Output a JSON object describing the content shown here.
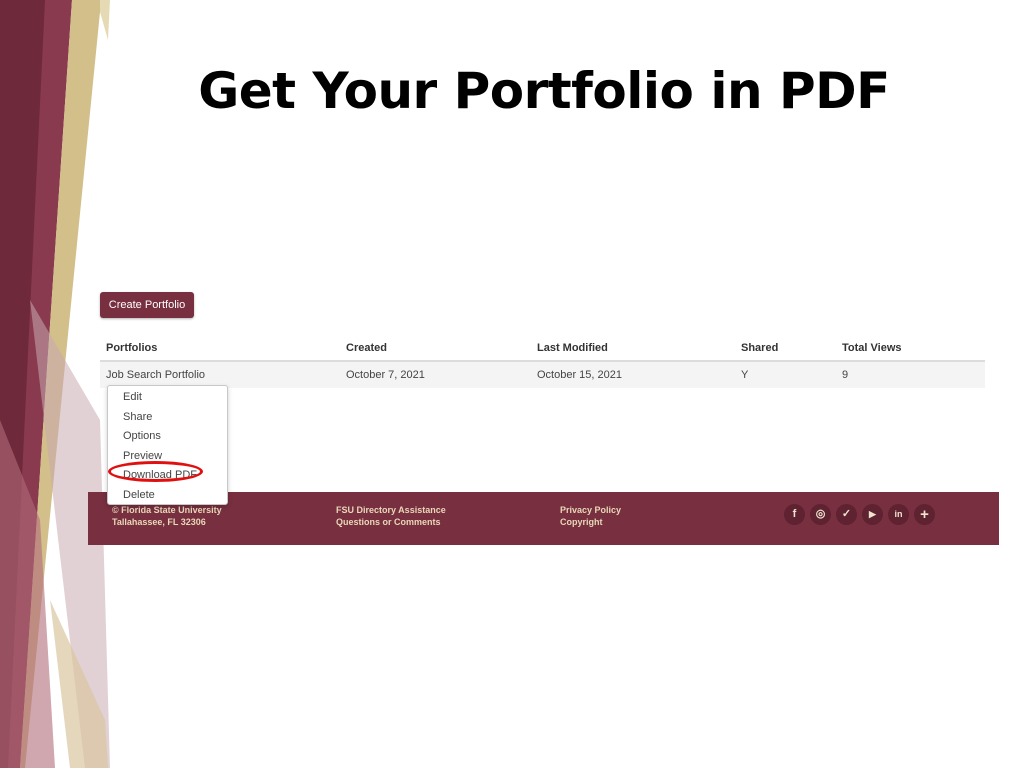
{
  "slide": {
    "title": "Get Your Portfolio in PDF"
  },
  "toolbar": {
    "create_label": "Create Portfolio"
  },
  "table": {
    "headers": [
      "Portfolios",
      "Created",
      "Last Modified",
      "Shared",
      "Total Views"
    ],
    "rows": [
      {
        "name": "Job Search Portfolio",
        "created": "October 7, 2021",
        "modified": "October 15, 2021",
        "shared": "Y",
        "views": "9"
      }
    ]
  },
  "menu": {
    "items": [
      "Edit",
      "Share",
      "Options",
      "Preview",
      "Download PDF",
      "Delete"
    ],
    "highlighted": "Download PDF"
  },
  "footer": {
    "col1": [
      "© Florida State University",
      "Tallahassee, FL 32306"
    ],
    "col2": [
      "FSU Directory Assistance",
      "Questions or Comments"
    ],
    "col3": [
      "Privacy Policy",
      "Copyright"
    ],
    "social": [
      {
        "icon": "facebook-icon",
        "glyph": "f"
      },
      {
        "icon": "instagram-icon",
        "glyph": "◎"
      },
      {
        "icon": "twitter-icon",
        "glyph": "✓"
      },
      {
        "icon": "youtube-icon",
        "glyph": "▶"
      },
      {
        "icon": "linkedin-icon",
        "glyph": "in"
      },
      {
        "icon": "plus-icon",
        "glyph": "+"
      }
    ]
  },
  "colors": {
    "garnet": "#782f40",
    "gold": "#cbb57a",
    "highlight": "#e01010"
  }
}
